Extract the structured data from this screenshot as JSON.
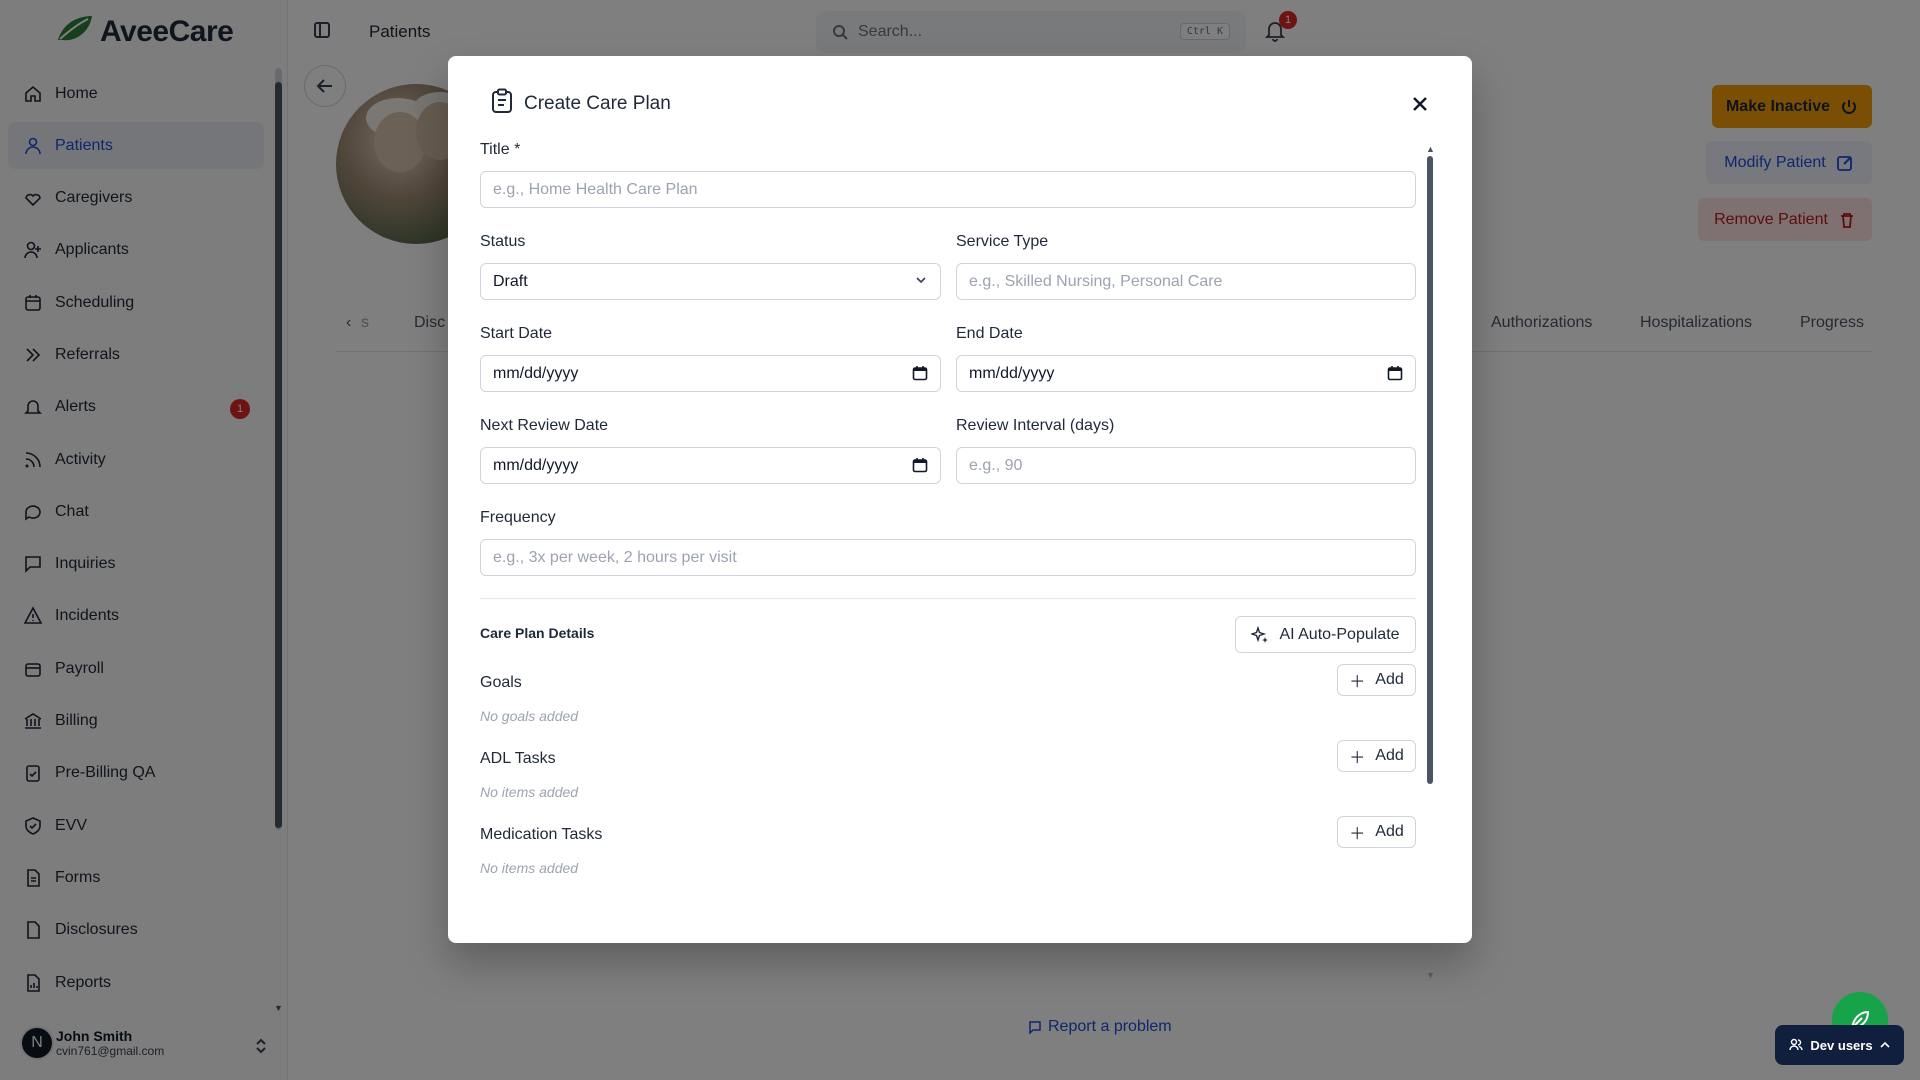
{
  "app": {
    "brand": "AveeCare"
  },
  "sidebar": {
    "items": [
      {
        "label": "Home",
        "icon": "home-icon"
      },
      {
        "label": "Patients",
        "icon": "user-icon",
        "active": true
      },
      {
        "label": "Caregivers",
        "icon": "caregivers-icon"
      },
      {
        "label": "Applicants",
        "icon": "user-plus-icon"
      },
      {
        "label": "Scheduling",
        "icon": "calendar-icon"
      },
      {
        "label": "Referrals",
        "icon": "referrals-icon"
      },
      {
        "label": "Alerts",
        "icon": "bell-icon",
        "badge": "1"
      },
      {
        "label": "Activity",
        "icon": "rss-icon"
      },
      {
        "label": "Chat",
        "icon": "chat-icon"
      },
      {
        "label": "Inquiries",
        "icon": "message-square-icon"
      },
      {
        "label": "Incidents",
        "icon": "warning-icon"
      },
      {
        "label": "Payroll",
        "icon": "wallet-icon"
      },
      {
        "label": "Billing",
        "icon": "bank-icon"
      },
      {
        "label": "Pre-Billing QA",
        "icon": "clipboard-check-icon"
      },
      {
        "label": "EVV",
        "icon": "shield-check-icon"
      },
      {
        "label": "Forms",
        "icon": "file-text-icon"
      },
      {
        "label": "Disclosures",
        "icon": "file-icon"
      },
      {
        "label": "Reports",
        "icon": "chart-file-icon"
      }
    ],
    "user": {
      "initial": "N",
      "name": "John Smith",
      "email": "cvin761@gmail.com"
    }
  },
  "header": {
    "breadcrumb": "Patients",
    "search_placeholder": "Search...",
    "search_shortcut": "Ctrl K",
    "notification_count": "1"
  },
  "patient_actions": {
    "make_inactive": "Make Inactive",
    "modify": "Modify Patient",
    "remove": "Remove Patient"
  },
  "tabs": {
    "left_fragment": "s",
    "left_partial": "Disc",
    "right": [
      "Authorizations",
      "Hospitalizations",
      "Progress"
    ]
  },
  "footer": {
    "report_problem": "Report a problem",
    "dev_users": "Dev users"
  },
  "modal": {
    "title": "Create Care Plan",
    "fields": {
      "title": {
        "label": "Title *",
        "placeholder": "e.g., Home Health Care Plan"
      },
      "status": {
        "label": "Status",
        "value": "Draft"
      },
      "service_type": {
        "label": "Service Type",
        "placeholder": "e.g., Skilled Nursing, Personal Care"
      },
      "start_date": {
        "label": "Start Date",
        "value": "mm/dd/yyyy"
      },
      "end_date": {
        "label": "End Date",
        "value": "mm/dd/yyyy"
      },
      "next_review_date": {
        "label": "Next Review Date",
        "value": "mm/dd/yyyy"
      },
      "review_interval": {
        "label": "Review Interval (days)",
        "placeholder": "e.g., 90"
      },
      "frequency": {
        "label": "Frequency",
        "placeholder": "e.g., 3x per week, 2 hours per visit"
      }
    },
    "details": {
      "section_title": "Care Plan Details",
      "ai_button": "AI Auto-Populate",
      "goals": {
        "label": "Goals",
        "empty": "No goals added",
        "add": "Add"
      },
      "adl_tasks": {
        "label": "ADL Tasks",
        "empty": "No items added",
        "add": "Add"
      },
      "medication_tasks": {
        "label": "Medication Tasks",
        "empty": "No items added",
        "add": "Add"
      }
    }
  },
  "colors": {
    "accent": "#1d4ed8",
    "warning": "#f59e0b",
    "danger": "#dc2626",
    "dev_bar": "#0f1f3d",
    "fab": "#16a34a"
  }
}
